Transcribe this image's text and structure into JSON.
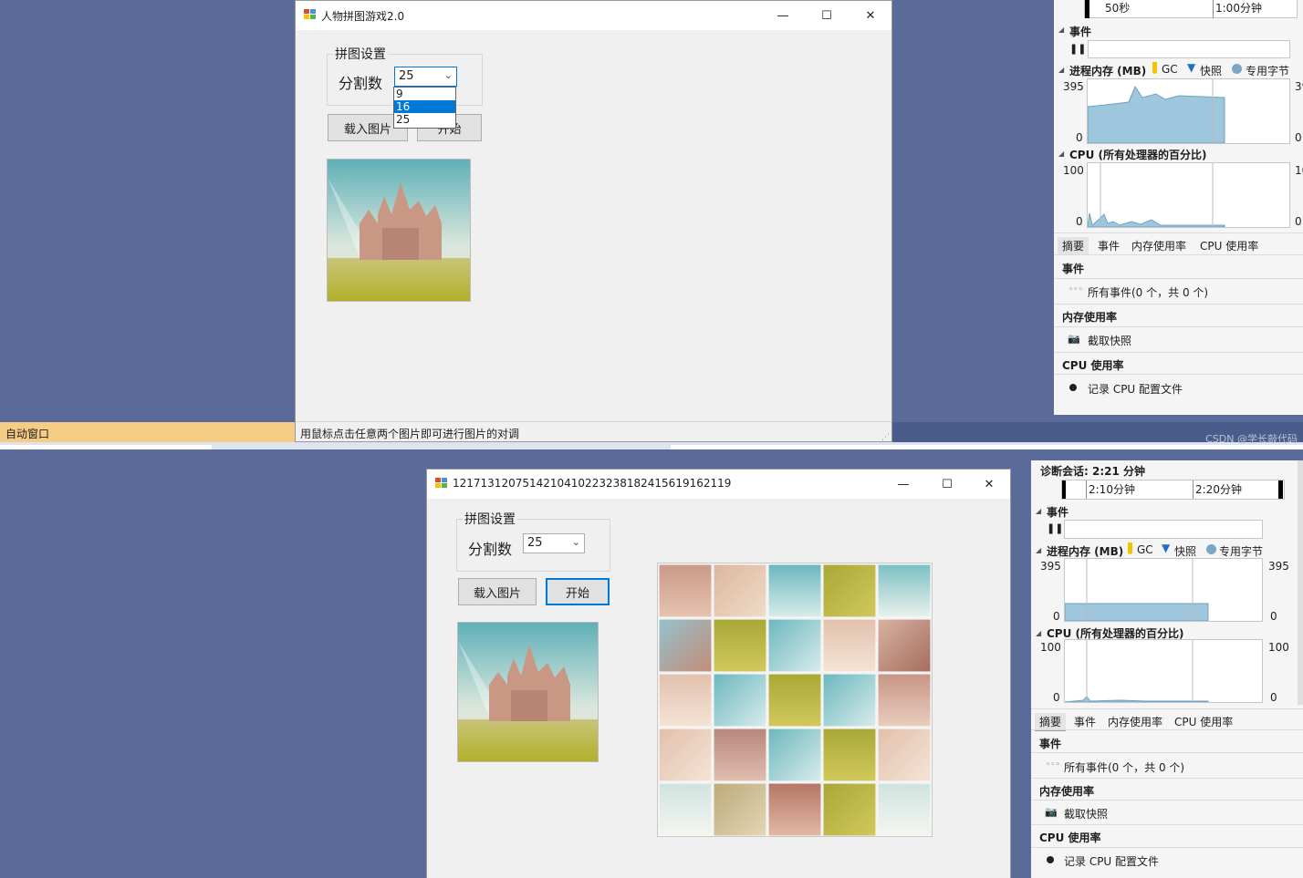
{
  "windows": [
    {
      "title": "人物拼图游戏2.0",
      "groupbox_title": "拼图设置",
      "split_label": "分割数",
      "split_value": "25",
      "dropdown_options": [
        "9",
        "16",
        "25"
      ],
      "dropdown_highlighted": "16",
      "load_button": "载入图片",
      "start_button": "开始",
      "status_text": "用鼠标点击任意两个图片即可进行图片的对调"
    },
    {
      "title": "1217131207514210410223238182415619162119",
      "groupbox_title": "拼图设置",
      "split_label": "分割数",
      "split_value": "25",
      "load_button": "载入图片",
      "start_button": "开始"
    }
  ],
  "caption_buttons": {
    "minimize": "—",
    "maximize": "☐",
    "close": "✕"
  },
  "vs": {
    "auto_window": "自动窗口",
    "watermark": "CSDN @学长敲代码"
  },
  "diag_panels": [
    {
      "session": "",
      "ticks": [
        "50秒",
        "1:00分钟"
      ],
      "events_label": "事件",
      "memory_label": "进程内存 (MB)",
      "legend": [
        "GC",
        "快照",
        "专用字节"
      ],
      "mem_max": "395",
      "mem_min": "0",
      "mem_right_max": "39",
      "mem_right_min": "0",
      "cpu_label": "CPU (所有处理器的百分比)",
      "cpu_max": "100",
      "cpu_min": "0",
      "cpu_right_max": "10",
      "cpu_right_min": "0",
      "tabs": [
        "摘要",
        "事件",
        "内存使用率",
        "CPU 使用率"
      ],
      "sec_events": "事件",
      "all_events": "所有事件(0 个，共 0 个)",
      "sec_memory": "内存使用率",
      "snapshot": "截取快照",
      "sec_cpu": "CPU 使用率",
      "record_cpu": "记录 CPU 配置文件"
    },
    {
      "session": "诊断会话: 2:21 分钟",
      "ticks": [
        "2:10分钟",
        "2:20分钟"
      ],
      "events_label": "事件",
      "memory_label": "进程内存 (MB)",
      "legend": [
        "GC",
        "快照",
        "专用字节"
      ],
      "mem_max": "395",
      "mem_min": "0",
      "mem_right_max": "395",
      "mem_right_min": "0",
      "cpu_label": "CPU (所有处理器的百分比)",
      "cpu_max": "100",
      "cpu_min": "0",
      "cpu_right_max": "100",
      "cpu_right_min": "0",
      "tabs": [
        "摘要",
        "事件",
        "内存使用率",
        "CPU 使用率"
      ],
      "sec_events": "事件",
      "all_events": "所有事件(0 个，共 0 个)",
      "sec_memory": "内存使用率",
      "snapshot": "截取快照",
      "sec_cpu": "CPU 使用率",
      "record_cpu": "记录 CPU 配置文件"
    }
  ],
  "colors": {
    "desktop": "#5b6b99",
    "accent": "#0078d7",
    "chart_fill": "#9ec6dd",
    "gc": "#f2c300",
    "snapshot": "#1f6fc4"
  },
  "puzzle": {
    "rows": 5,
    "cols": 5,
    "tiles": [
      "castle-tower",
      "castle-wall",
      "sky",
      "meadow",
      "sky-cloud",
      "tower-top",
      "meadow",
      "sky",
      "wall",
      "spire",
      "wall",
      "sky",
      "meadow",
      "sky",
      "castle-side",
      "wall",
      "castle",
      "sky",
      "meadow",
      "wall",
      "cloud",
      "meadow-road",
      "castle-front",
      "meadow",
      "cloud"
    ]
  }
}
